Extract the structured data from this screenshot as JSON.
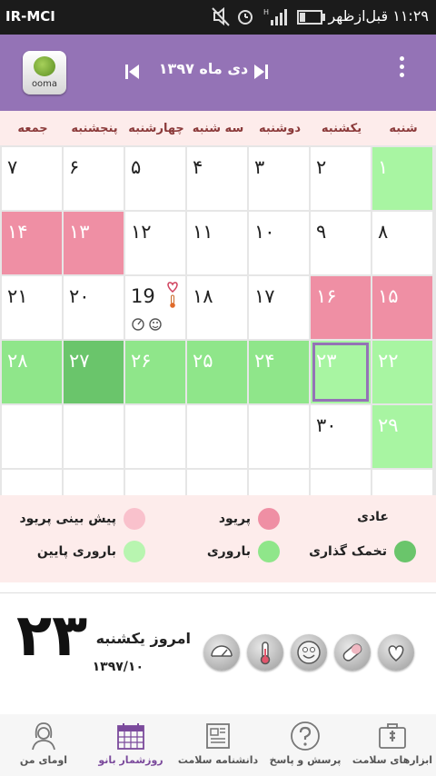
{
  "status_bar": {
    "carrier": "IR-MCI",
    "time": "۱۱:۲۹ قبل‌ازظهر"
  },
  "app_bar": {
    "logo_text": "ooma",
    "month_title": "دی ماه ۱۳۹۷"
  },
  "weekdays": [
    "شنبه",
    "یکشنبه",
    "دوشنبه",
    "سه شنبه",
    "چهارشنبه",
    "پنجشنبه",
    "جمعه"
  ],
  "calendar": {
    "weeks": [
      [
        {
          "d": "۱",
          "s": "low-fert"
        },
        {
          "d": "۲",
          "s": ""
        },
        {
          "d": "۳",
          "s": ""
        },
        {
          "d": "۴",
          "s": ""
        },
        {
          "d": "۵",
          "s": ""
        },
        {
          "d": "۶",
          "s": ""
        },
        {
          "d": "۷",
          "s": ""
        }
      ],
      [
        {
          "d": "۸",
          "s": ""
        },
        {
          "d": "۹",
          "s": ""
        },
        {
          "d": "۱۰",
          "s": ""
        },
        {
          "d": "۱۱",
          "s": ""
        },
        {
          "d": "۱۲",
          "s": ""
        },
        {
          "d": "۱۳",
          "s": "period"
        },
        {
          "d": "۱۴",
          "s": "period"
        }
      ],
      [
        {
          "d": "۱۵",
          "s": "period"
        },
        {
          "d": "۱۶",
          "s": "period"
        },
        {
          "d": "۱۷",
          "s": ""
        },
        {
          "d": "۱۸",
          "s": ""
        },
        {
          "d": "19",
          "s": "",
          "icons": true
        },
        {
          "d": "۲۰",
          "s": ""
        },
        {
          "d": "۲۱",
          "s": ""
        }
      ],
      [
        {
          "d": "۲۲",
          "s": "low-fert"
        },
        {
          "d": "۲۳",
          "s": "low-fert",
          "today": true
        },
        {
          "d": "۲۴",
          "s": "fert"
        },
        {
          "d": "۲۵",
          "s": "fert"
        },
        {
          "d": "۲۶",
          "s": "fert"
        },
        {
          "d": "۲۷",
          "s": "ovul"
        },
        {
          "d": "۲۸",
          "s": "fert"
        }
      ],
      [
        {
          "d": "۲۹",
          "s": "low-fert"
        },
        {
          "d": "۳۰",
          "s": ""
        },
        {
          "d": "",
          "s": ""
        },
        {
          "d": "",
          "s": ""
        },
        {
          "d": "",
          "s": ""
        },
        {
          "d": "",
          "s": ""
        },
        {
          "d": "",
          "s": ""
        }
      ],
      [
        {
          "d": "",
          "s": ""
        },
        {
          "d": "",
          "s": ""
        },
        {
          "d": "",
          "s": ""
        },
        {
          "d": "",
          "s": ""
        },
        {
          "d": "",
          "s": ""
        },
        {
          "d": "",
          "s": ""
        },
        {
          "d": "",
          "s": ""
        }
      ]
    ]
  },
  "legend": [
    {
      "label": "عادی",
      "color": ""
    },
    {
      "label": "پریود",
      "color": "#ef8fa4"
    },
    {
      "label": "پیش بینی پریود",
      "color": "#f9c1cc"
    },
    {
      "label": "تخمک گذاری",
      "color": "#6ac56b"
    },
    {
      "label": "باروری",
      "color": "#8fe68a"
    },
    {
      "label": "باروری پایین",
      "color": "#b8f5b0"
    }
  ],
  "today": {
    "big_number": "۲۳",
    "label": "امروز یکشنبه",
    "date": "۱۳۹۷/۱۰"
  },
  "tools": [
    "heart-icon",
    "pill-icon",
    "smiley-icon",
    "thermometer-icon",
    "scale-icon"
  ],
  "bottom_nav": [
    {
      "label": "ابزارهای سلامت",
      "icon": "first-aid-kit-icon",
      "active": false
    },
    {
      "label": "پرسش و پاسخ",
      "icon": "question-icon",
      "active": false
    },
    {
      "label": "دانشنامه سلامت",
      "icon": "newspaper-icon",
      "active": false
    },
    {
      "label": "روزشمار بانو",
      "icon": "calendar-icon",
      "active": true
    },
    {
      "label": "اومای من",
      "icon": "woman-profile-icon",
      "active": false
    }
  ],
  "colors": {
    "appbar": "#9473b6",
    "period": "#ef8fa4",
    "fertile": "#8fe68a",
    "ovulation": "#6ac56b",
    "low_fertile": "#a8f5a2"
  }
}
